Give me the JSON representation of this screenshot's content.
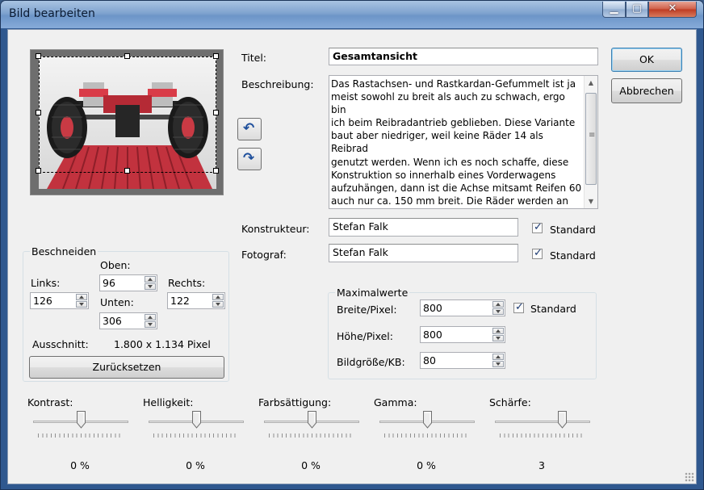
{
  "window": {
    "title": "Bild bearbeiten"
  },
  "buttons": {
    "ok": "OK",
    "cancel": "Abbrechen",
    "reset": "Zurücksetzen"
  },
  "fields": {
    "title_label": "Titel:",
    "title_value": "Gesamtansicht",
    "description_label": "Beschreibung:",
    "description_value": "Das Rastachsen- und Rastkardan-Gefummelt ist ja\nmeist sowohl zu breit als auch zu schwach, ergo bin\nich beim Reibradantrieb geblieben. Diese Variante\nbaut aber niedriger, weil keine Räder 14 als Reibrad\ngenutzt werden. Wenn ich es noch schaffe, diese\nKonstruktion so innerhalb eines Vorderwagens\naufzuhängen, dann ist die Achse mitsamt Reifen 60\nauch nur ca. 150 mm breit. Die Räder werden an vier\nStreben gehalten und gelenkt. Die beiden MiniMots\nmüssten dann in Serie geschaltet werden, wodurch",
    "constructor_label": "Konstrukteur:",
    "constructor_value": "Stefan Falk",
    "constructor_default": {
      "label": "Standard",
      "checked": true
    },
    "photographer_label": "Fotograf:",
    "photographer_value": "Stefan Falk",
    "photographer_default": {
      "label": "Standard",
      "checked": true
    }
  },
  "crop": {
    "group_title": "Beschneiden",
    "top_label": "Oben:",
    "top_value": "96",
    "left_label": "Links:",
    "left_value": "126",
    "right_label": "Rechts:",
    "right_value": "122",
    "bottom_label": "Unten:",
    "bottom_value": "306",
    "section_label": "Ausschnitt:",
    "section_value": "1.800 x 1.134 Pixel"
  },
  "max": {
    "group_title": "Maximalwerte",
    "width_label": "Breite/Pixel:",
    "width_value": "800",
    "width_default": {
      "label": "Standard",
      "checked": true
    },
    "height_label": "Höhe/Pixel:",
    "height_value": "800",
    "size_label": "Bildgröße/KB:",
    "size_value": "80"
  },
  "sliders": [
    {
      "label": "Kontrast:",
      "value": "0 %",
      "level": 0.5
    },
    {
      "label": "Helligkeit:",
      "value": "0 %",
      "level": 0.5
    },
    {
      "label": "Farbsättigung:",
      "value": "0 %",
      "level": 0.5
    },
    {
      "label": "Gamma:",
      "value": "0 %",
      "level": 0.5
    },
    {
      "label": "Schärfe:",
      "value": "3",
      "level": 0.7
    }
  ],
  "icons": {
    "rotate_left": "rotate-left-icon",
    "rotate_right": "rotate-right-icon",
    "minimize": "minimize-icon",
    "maximize": "maximize-icon",
    "close": "close-icon"
  },
  "colors": {
    "accent": "#3c7fb1",
    "window_frame": "#2f588f"
  }
}
